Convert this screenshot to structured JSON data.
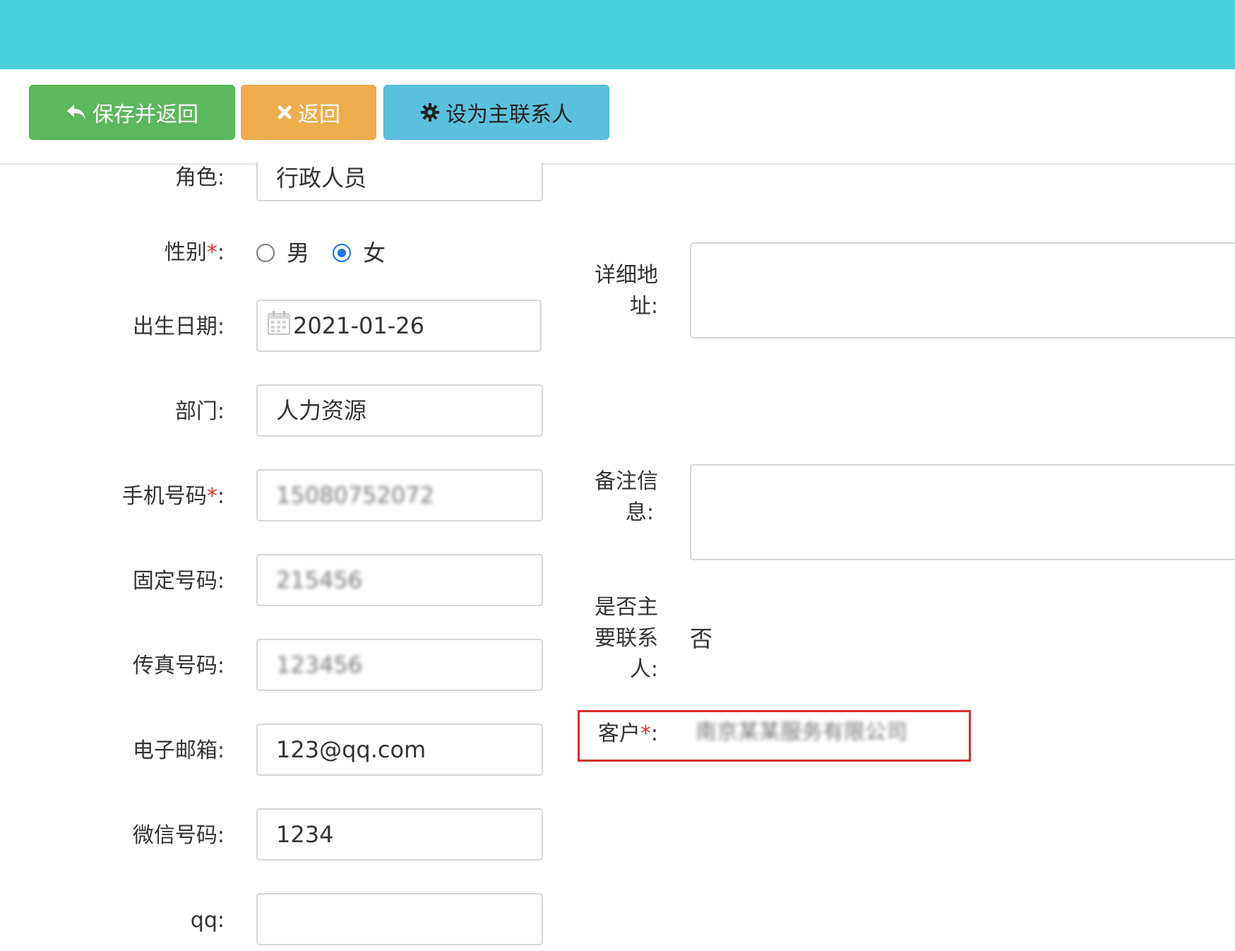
{
  "toolbar": {
    "save_return": {
      "label": "保存并返回",
      "icon": "reply-icon"
    },
    "back": {
      "label": "返回",
      "icon": "close-icon"
    },
    "set_primary": {
      "label": "设为主联系人",
      "icon": "gear-icon"
    }
  },
  "form": {
    "role": {
      "label": "角色:",
      "value": "行政人员"
    },
    "gender": {
      "label": "性别",
      "required_mark": "*",
      "colon": ":",
      "options": [
        "男",
        "女"
      ],
      "selected": "女"
    },
    "birth_date": {
      "label": "出生日期:",
      "value": "2021-01-26",
      "icon": "calendar-icon"
    },
    "department": {
      "label": "部门:",
      "value": "人力资源"
    },
    "mobile": {
      "label": "手机号码",
      "required_mark": "*",
      "colon": ":",
      "value": "15080752072"
    },
    "landline": {
      "label": "固定号码:",
      "value": "215456"
    },
    "fax": {
      "label": "传真号码:",
      "value": "123456"
    },
    "email": {
      "label": "电子邮箱:",
      "value": "123@qq.com"
    },
    "wechat": {
      "label": "微信号码:",
      "value": "1234"
    },
    "qq": {
      "label": "qq:",
      "value": ""
    },
    "address": {
      "label_line1": "详细地",
      "label_line2": "址:",
      "value": ""
    },
    "remarks": {
      "label_line1": "备注信",
      "label_line2": "息:",
      "value": ""
    },
    "is_primary": {
      "label_line1": "是否主",
      "label_line2": "要联系",
      "label_line3": "人:",
      "value": "否"
    },
    "customer": {
      "label": "客户",
      "required_mark": "*",
      "colon": ":",
      "value": "南京某某服务有限公司"
    }
  },
  "colors": {
    "header": "#48d1db",
    "save_button": "#5cb85c",
    "back_button": "#f0ad4e",
    "primary_button": "#5bc0de",
    "required": "#e03232",
    "highlight": "#d92c2c",
    "radio_checked": "#1a73e8"
  }
}
